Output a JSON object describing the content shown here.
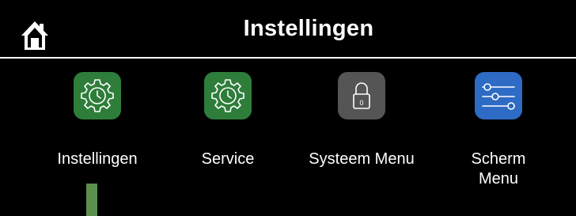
{
  "header": {
    "title": "Instellingen"
  },
  "colors": {
    "green": "#2e7d3a",
    "gray": "#555555",
    "blue": "#2e6bc4",
    "indicator": "#5a8f4e"
  },
  "tiles": [
    {
      "label": "Instellingen",
      "icon": "gear-clock-icon"
    },
    {
      "label": "Service",
      "icon": "gear-clock-icon"
    },
    {
      "label": "Systeem Menu",
      "icon": "padlock-icon",
      "lock_text": "0"
    },
    {
      "label": "Scherm\nMenu",
      "icon": "sliders-icon"
    }
  ]
}
